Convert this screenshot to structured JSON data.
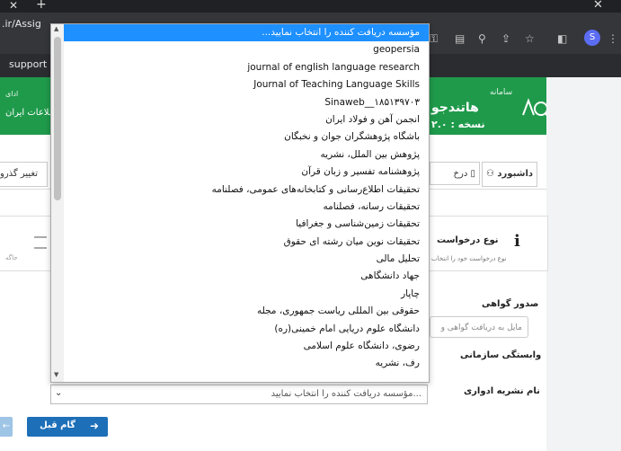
{
  "browser": {
    "url_fragment": ".ir/Assig",
    "bookmark": "support"
  },
  "header": {
    "brand_top": "سامانه",
    "brand_name": "هاتندجو",
    "version": "نسخه : ۲.۰",
    "left_top": "ادای",
    "left_bottom": "طلاعات ایران",
    "color": "#1f9a4b"
  },
  "nav": {
    "dashboard": "داشبورد",
    "second": "درخ",
    "change": "تغییر گذرو"
  },
  "info": {
    "icon": "info-icon",
    "title": "نوع درخواست",
    "desc": "نوع درخواست خود را انتخاب",
    "left_text": "جاگه"
  },
  "form": {
    "certificate_label": "صدور گواهی",
    "certificate_placeholder": "مایل به دریافت گواهی و",
    "affiliation_label": "وابستگی سازمانی",
    "journal_label": "نام نشریه ادواری",
    "select_value": "مؤسسه دریافت کننده را انتخاب نمایید..."
  },
  "buttons": {
    "prev": "گام قبل"
  },
  "dropdown": {
    "selected_color": "#1e90ff",
    "options": [
      "مؤسسه دریافت کننده را انتخاب نمایید...",
      "geopersia",
      "journal of english language research",
      "Journal of Teaching Language Skills",
      "Sinaweb__۱۸۵۱۳۹۷۰۳",
      "انجمن آهن و فولاد ایران",
      "باشگاه پژوهشگران جوان و نخبگان",
      "پژوهش بین الملل، نشریه",
      "پژوهشنامه تفسیر و زبان قرآن",
      "تحقیقات اطلاع‌رسانی و کتابخانه‌های عمومی، فصلنامه",
      "تحقیقات رسانه، فصلنامه",
      "تحقیقات زمین‌شناسی و جغرافیا",
      "تحقیقات نوین میان رشته ای حقوق",
      "تحلیل مالی",
      "جهاد دانشگاهی",
      "چاپار",
      "حقوقی بین المللی ریاست جمهوری، مجله",
      "دانشگاه علوم دریایی امام خمینی(ره)",
      "رضوی، دانشگاه علوم اسلامی",
      "رف، نشریه"
    ]
  }
}
